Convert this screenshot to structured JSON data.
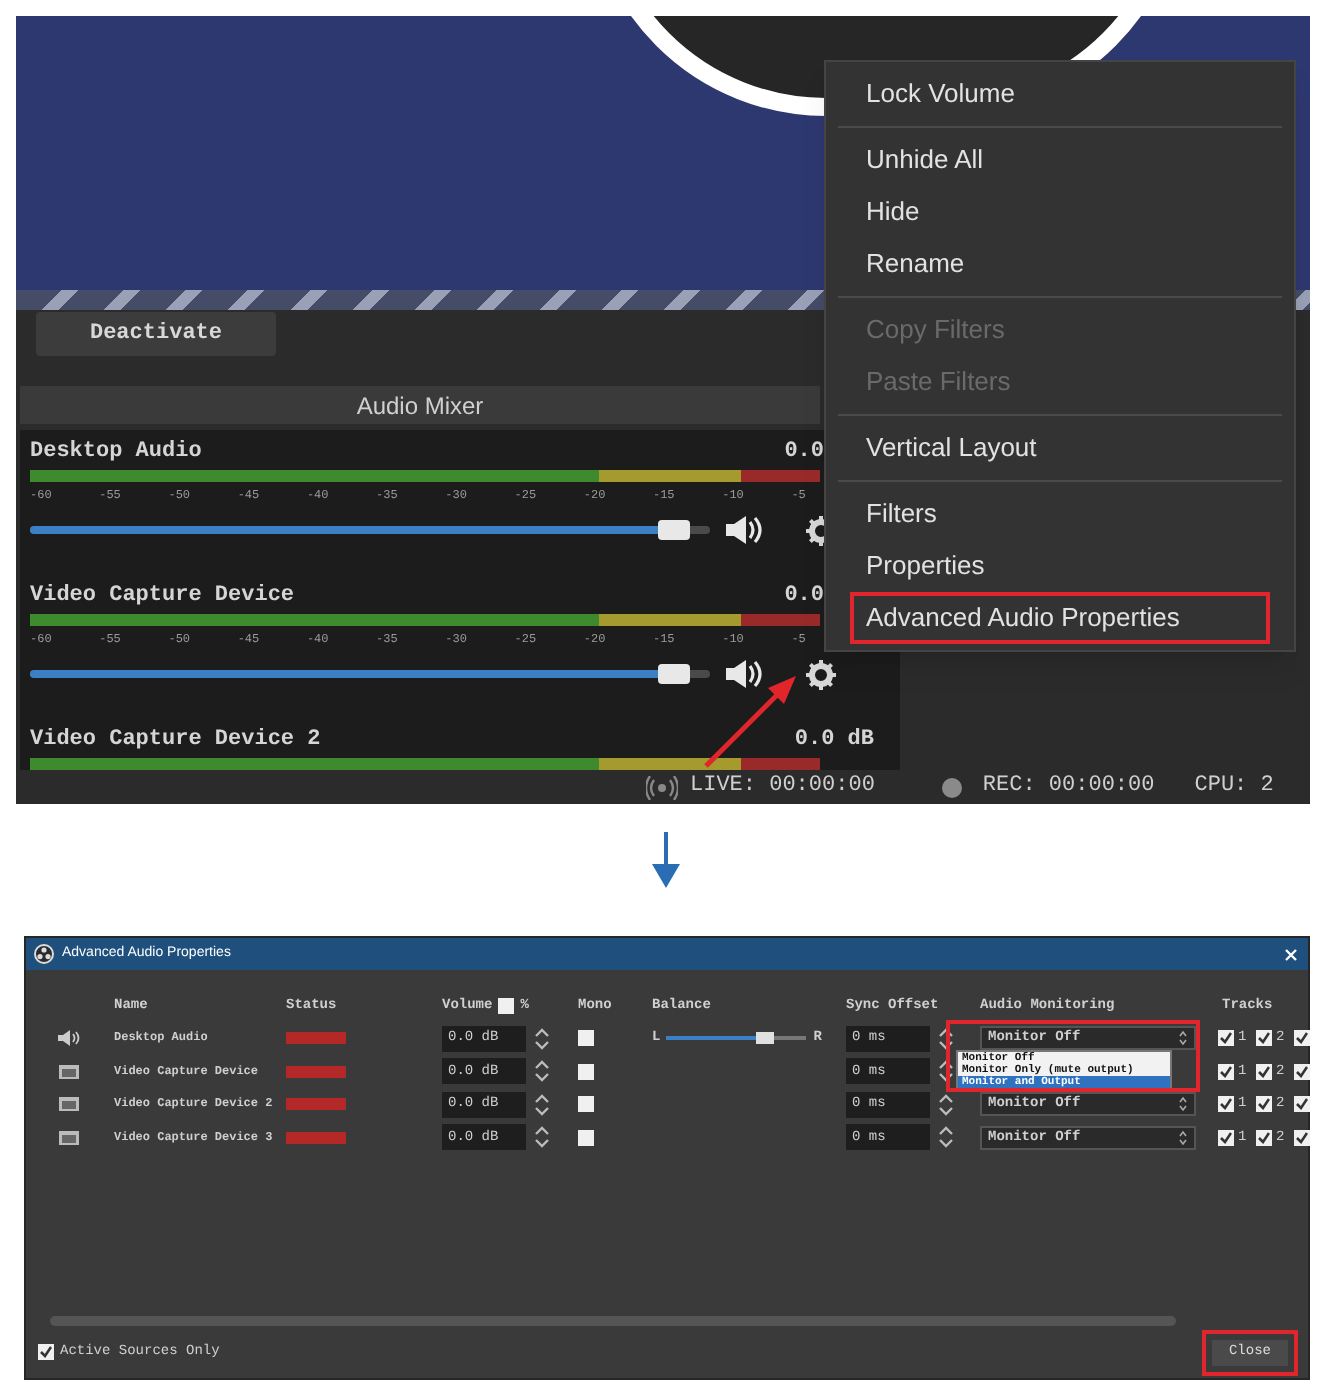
{
  "main_window": {
    "deactivate_button": "Deactivate",
    "mixer": {
      "title": "Audio Mixer",
      "channels": [
        {
          "name": "Desktop Audio",
          "reading": "0.0",
          "scale": [
            "-60",
            "-55",
            "-50",
            "-45",
            "-40",
            "-35",
            "-30",
            "-25",
            "-20",
            "-15",
            "-10",
            "-5"
          ],
          "level": 0.97
        },
        {
          "name": "Video Capture Device",
          "reading": "0.0",
          "scale": [
            "-60",
            "-55",
            "-50",
            "-45",
            "-40",
            "-35",
            "-30",
            "-25",
            "-20",
            "-15",
            "-10",
            "-5"
          ],
          "level": 0.97
        },
        {
          "name": "Video Capture Device 2",
          "reading": "0.0 dB"
        }
      ]
    },
    "status_bar": {
      "live": "LIVE: 00:00:00",
      "rec": "REC: 00:00:00",
      "cpu": "CPU: 2"
    },
    "context_menu": {
      "sections": [
        [
          {
            "label": "Lock Volume",
            "disabled": false,
            "marked": false
          }
        ],
        [
          {
            "label": "Unhide All",
            "disabled": false,
            "marked": false
          },
          {
            "label": "Hide",
            "disabled": false,
            "marked": false
          },
          {
            "label": "Rename",
            "disabled": false,
            "marked": false
          }
        ],
        [
          {
            "label": "Copy Filters",
            "disabled": true,
            "marked": false
          },
          {
            "label": "Paste Filters",
            "disabled": true,
            "marked": false
          }
        ],
        [
          {
            "label": "Vertical Layout",
            "disabled": false,
            "marked": false
          }
        ],
        [
          {
            "label": "Filters",
            "disabled": false,
            "marked": false
          },
          {
            "label": "Properties",
            "disabled": false,
            "marked": false
          },
          {
            "label": "Advanced Audio Properties",
            "disabled": false,
            "marked": true
          }
        ]
      ]
    }
  },
  "dialog": {
    "title": "Advanced Audio Properties",
    "columns": {
      "name": "Name",
      "status": "Status",
      "volume": "Volume",
      "percent": {
        "label": "%",
        "checked": false
      },
      "mono": "Mono",
      "balance": "Balance",
      "sync": "Sync Offset",
      "monitoring": "Audio Monitoring",
      "tracks": "Tracks"
    },
    "rows": [
      {
        "kind": "audio",
        "name": "Desktop Audio",
        "volume": "0.0 dB",
        "mono": false,
        "balance": {
          "left": "L",
          "right": "R",
          "level": 0.7
        },
        "sync": "0 ms",
        "monitoring": "Monitor Off",
        "tracks": [
          {
            "label": "1",
            "checked": true
          },
          {
            "label": "2",
            "checked": true
          },
          {
            "checked": true
          }
        ]
      },
      {
        "kind": "video",
        "name": "Video Capture Device",
        "volume": "0.0 dB",
        "mono": false,
        "sync": "0 ms",
        "tracks": [
          {
            "label": "1",
            "checked": true
          },
          {
            "label": "2",
            "checked": true
          },
          {
            "checked": true
          }
        ]
      },
      {
        "kind": "video",
        "name": "Video Capture Device 2",
        "volume": "0.0 dB",
        "mono": false,
        "sync": "0 ms",
        "monitoring": "Monitor Off",
        "tracks": [
          {
            "label": "1",
            "checked": true
          },
          {
            "label": "2",
            "checked": true
          },
          {
            "checked": true
          }
        ]
      },
      {
        "kind": "video",
        "name": "Video Capture Device 3",
        "volume": "0.0 dB",
        "mono": false,
        "sync": "0 ms",
        "monitoring": "Monitor Off",
        "tracks": [
          {
            "label": "1",
            "checked": true
          },
          {
            "label": "2",
            "checked": true
          },
          {
            "checked": true
          }
        ]
      }
    ],
    "monitoring_popup": {
      "marked": true,
      "options": [
        {
          "label": "Monitor Off",
          "selected": false
        },
        {
          "label": "Monitor Only (mute output)",
          "selected": false
        },
        {
          "label": "Monitor and Output",
          "selected": true
        }
      ]
    },
    "active_sources_only": {
      "label": "Active Sources Only",
      "checked": true
    },
    "close_button": {
      "label": "Close",
      "marked": true
    }
  }
}
